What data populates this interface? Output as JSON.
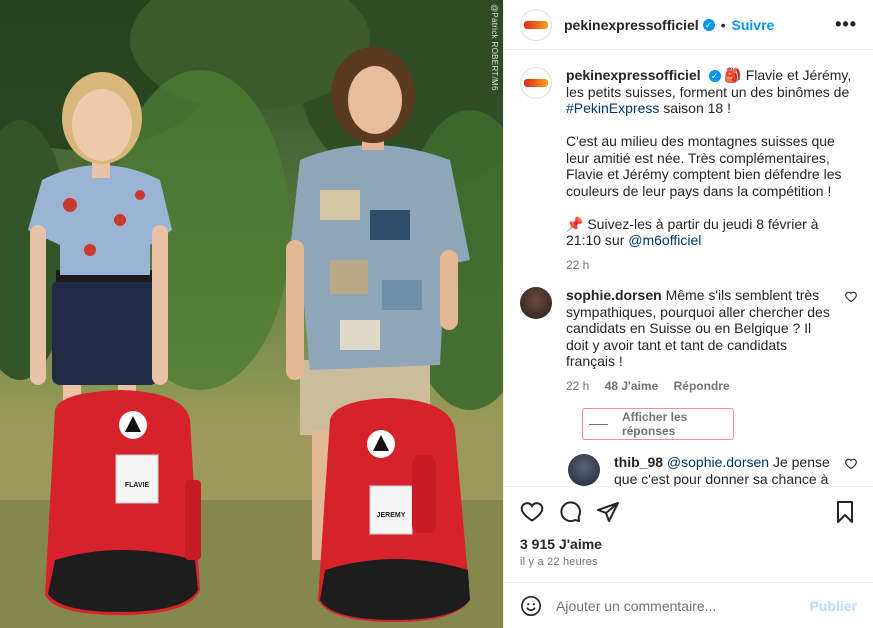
{
  "photo": {
    "credit": "@Patrick ROBERT/M6",
    "bag_labels": [
      "FLAVIE",
      "JEREMY"
    ]
  },
  "header": {
    "username": "pekinexpressofficiel",
    "separator": "•",
    "follow_label": "Suivre",
    "more_icon": "more-horizontal-icon"
  },
  "caption": {
    "username": "pekinexpressofficiel",
    "emoji": "🎒",
    "line1": "Flavie et Jérémy, les petits suisses, forment un des binômes de",
    "hashtag": "#PekinExpress",
    "line1_end": "saison 18 !",
    "para2": "C'est au milieu des montagnes suisses que leur amitié est née. Très complémentaires, Flavie et Jérémy comptent bien défendre les couleurs de leur pays dans la compétition !",
    "pin": "📌",
    "para3": "Suivez-les à partir du jeudi 8 février à 21:10 sur",
    "mention": "@m6officiel",
    "time": "22 h"
  },
  "comments": [
    {
      "username": "sophie.dorsen",
      "text": "Même s'ils semblent très sympathiques, pourquoi aller chercher des candidats en Suisse ou en Belgique ? Il doit y avoir tant et tant de candidats français !",
      "time": "22 h",
      "likes": "48 J'aime",
      "reply": "Répondre"
    }
  ],
  "replies_toggle": "Afficher les réponses",
  "reply": {
    "username": "thib_98",
    "mention": "@sophie.dorsen",
    "text": "Je pense que c'est pour donner sa chance à tout le monde d'y participer, dont les"
  },
  "actions": {
    "like": "heart-icon",
    "comment": "comment-icon",
    "share": "share-icon",
    "save": "bookmark-icon"
  },
  "likes": "3 915 J'aime",
  "timestamp": "il y a 22 heures",
  "comment_box": {
    "placeholder": "Ajouter un commentaire...",
    "publish": "Publier",
    "emoji_icon": "smiley-icon"
  },
  "colors": {
    "accent": "#0095f6",
    "bag_red": "#d8222b",
    "text": "#262626",
    "muted": "#737373"
  }
}
